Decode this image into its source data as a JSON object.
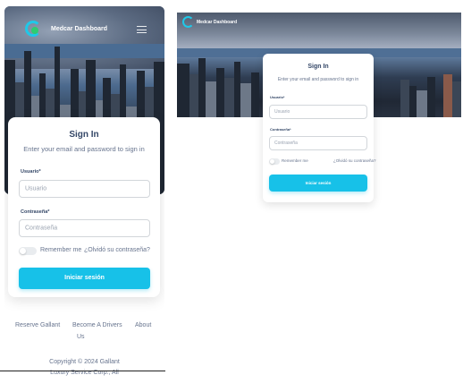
{
  "brand": {
    "name": "Medcar Dashboard"
  },
  "signin": {
    "title": "Sign In",
    "subtitle": "Enter your email and password to sign in",
    "username_label": "Usuario*",
    "username_placeholder": "Usuario",
    "password_label": "Contraseña*",
    "password_placeholder": "Contraseña",
    "remember_label": "Remember me",
    "forgot_label": "¿Olvidó su contraseña?",
    "submit_label": "Iniciar sesión"
  },
  "desktop_signin": {
    "username_label": "Usuario*",
    "password_label": "Contraseña*",
    "forgot_label": "¿Olvidó su contraseña?"
  },
  "footer": {
    "links": [
      "Reserve Gallant",
      "Become A Drivers",
      "About",
      "Us"
    ],
    "copyright_line1": "Copyright © 2024 Gallant",
    "copyright_line2": "Luxury Service Corp., All"
  },
  "colors": {
    "accent": "#17c1e8",
    "logo_green": "#2ecc71",
    "text": "#344767",
    "muted": "#67748e"
  },
  "icons": [
    "logo-icon",
    "hamburger-menu-icon"
  ]
}
